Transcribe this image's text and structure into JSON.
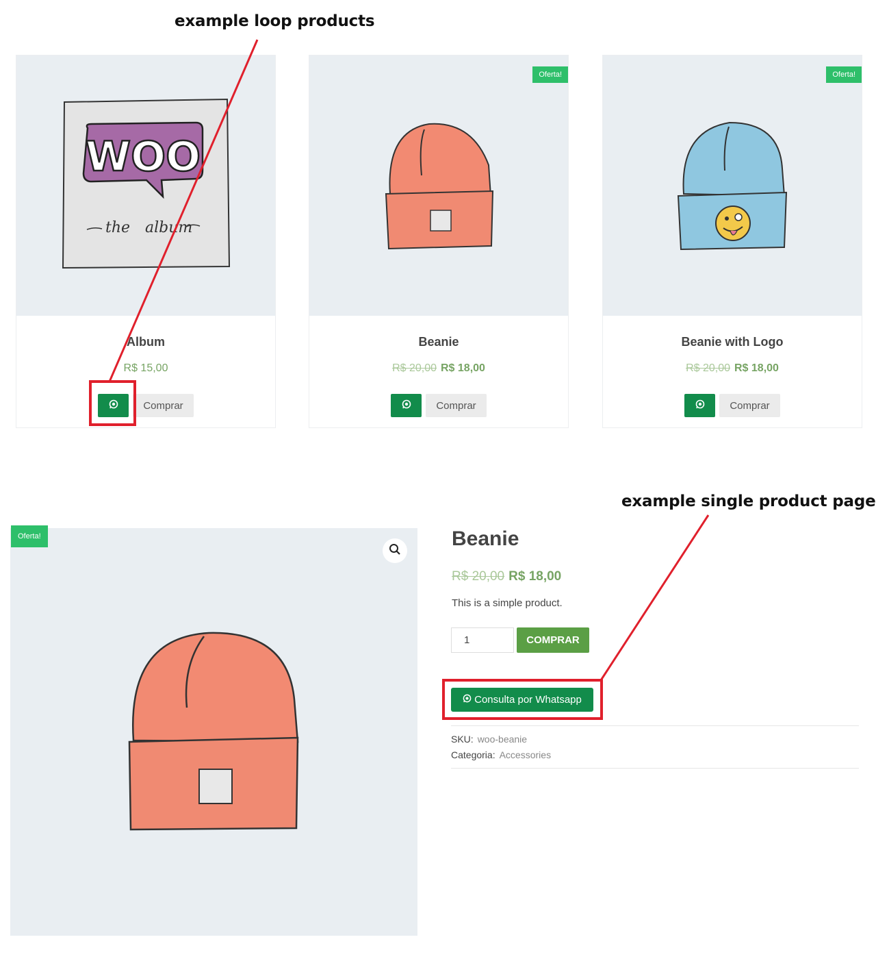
{
  "annotations": {
    "loop_label": "example loop products",
    "single_label": "example single product page"
  },
  "loop": {
    "products": [
      {
        "title": "Album",
        "badge": "",
        "price_old": "",
        "price": "R$ 15,00",
        "image_text": {
          "logo": "WOO",
          "caption_left": "the",
          "caption_right": "album"
        },
        "buy_label": "Comprar"
      },
      {
        "title": "Beanie",
        "badge": "Oferta!",
        "price_old": "R$ 20,00",
        "price": "R$ 18,00",
        "buy_label": "Comprar"
      },
      {
        "title": "Beanie with Logo",
        "badge": "Oferta!",
        "price_old": "R$ 20,00",
        "price": "R$ 18,00",
        "buy_label": "Comprar"
      }
    ]
  },
  "single": {
    "badge": "Oferta!",
    "title": "Beanie",
    "price_old": "R$ 20,00",
    "price": "R$ 18,00",
    "description": "This is a simple product.",
    "quantity": "1",
    "add_to_cart_label": "COMPRAR",
    "whatsapp_label": "Consulta por Whatsapp",
    "sku_label": "SKU:",
    "sku_value": "woo-beanie",
    "category_label": "Categoria:",
    "category_value": "Accessories"
  },
  "colors": {
    "whatsapp_green": "#128c4b",
    "sale_badge": "#2ebf6a",
    "price_green": "#77a464",
    "cart_button": "#5b9f45",
    "annotation_red": "#e0202c"
  },
  "icons": [
    "whatsapp-icon",
    "search-icon"
  ]
}
